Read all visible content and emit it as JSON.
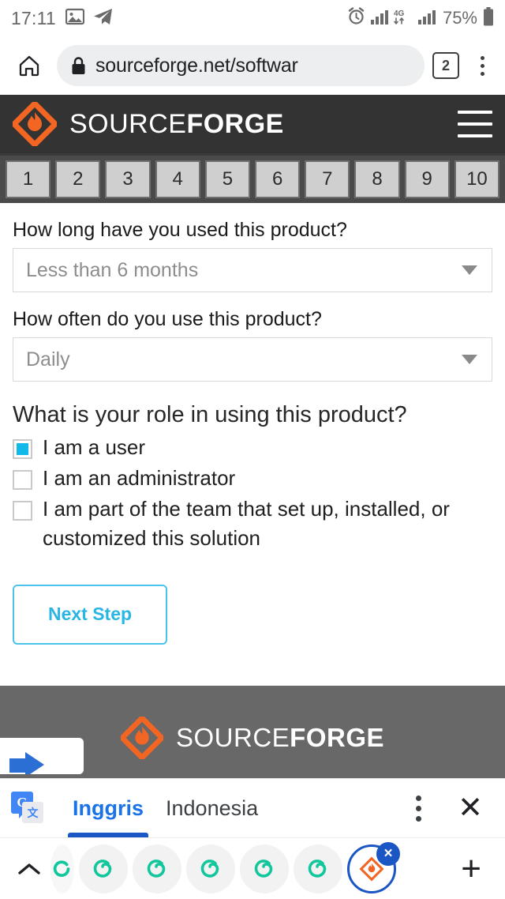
{
  "status_bar": {
    "time": "17:11",
    "left_icons": [
      "image-icon",
      "telegram-send-icon"
    ],
    "right_icons": [
      "alarm-clock-icon",
      "signal-bars-icon",
      "4g-icon",
      "signal-bars-2-icon"
    ],
    "network_label": "4G",
    "battery_percent": "75%"
  },
  "browser": {
    "home_icon": "home-icon",
    "lock_icon": "lock-icon",
    "url": "sourceforge.net/softwar",
    "tab_count": "2",
    "menu_icon": "three-dot-menu-icon"
  },
  "site_header": {
    "logo_icon": "sourceforge-flame-logo",
    "brand_light": "SOURCE",
    "brand_bold": "FORGE",
    "menu_icon": "hamburger-menu-icon"
  },
  "rating": {
    "options": [
      "1",
      "2",
      "3",
      "4",
      "5",
      "6",
      "7",
      "8",
      "9",
      "10"
    ]
  },
  "form": {
    "question1": {
      "label": "How long have you used this product?",
      "value": "Less than 6 months",
      "arrow_icon": "chevron-down-icon"
    },
    "question2": {
      "label": "How often do you use this product?",
      "value": "Daily",
      "arrow_icon": "chevron-down-icon"
    },
    "question3": {
      "label": "What is your role in using this product?",
      "checkboxes": [
        {
          "label": "I am a user",
          "checked": true
        },
        {
          "label": "I am an administrator",
          "checked": false
        },
        {
          "label": "I am part of the team that set up, installed, or customized this solution",
          "checked": false
        }
      ]
    },
    "next_button": "Next Step"
  },
  "footer": {
    "brand_light": "SOURCE",
    "brand_bold": "FORGE",
    "logo_icon": "sourceforge-flame-logo"
  },
  "translate_bar": {
    "icon": "google-translate-icon",
    "source_language": "Inggris",
    "target_language": "Indonesia",
    "menu_icon": "three-dot-menu-icon",
    "close_icon": "close-x-icon"
  },
  "tab_strip": {
    "expand_icon": "chevron-up-icon",
    "tabs": [
      {
        "icon": "green-spiral-favicon",
        "active": false,
        "partial": true
      },
      {
        "icon": "green-spiral-favicon",
        "active": false
      },
      {
        "icon": "green-spiral-favicon",
        "active": false
      },
      {
        "icon": "green-spiral-favicon",
        "active": false
      },
      {
        "icon": "green-spiral-favicon",
        "active": false
      },
      {
        "icon": "green-spiral-favicon",
        "active": false
      },
      {
        "icon": "sourceforge-favicon",
        "active": true,
        "close_label": "×"
      }
    ],
    "new_tab_label": "+"
  },
  "colors": {
    "header_dark": "#333333",
    "brand_orange": "#F26522",
    "accent_cyan": "#29b6e5",
    "checkbox_cyan": "#10b9e8",
    "translate_blue": "#1a73e8",
    "tab_ring_blue": "#1a56c4",
    "footer_gray": "#686868"
  }
}
